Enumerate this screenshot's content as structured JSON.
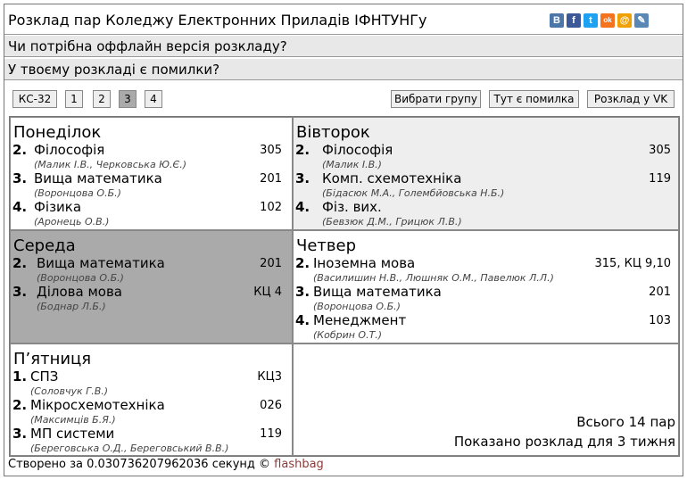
{
  "header": {
    "title": "Розклад пар Коледжу Електронних Приладів ІФНТУНГу",
    "share_icons": [
      {
        "name": "vk-icon",
        "glyph": "В",
        "color": "#4a76a8"
      },
      {
        "name": "facebook-icon",
        "glyph": "f",
        "color": "#3b5998"
      },
      {
        "name": "twitter-icon",
        "glyph": "t",
        "color": "#1da1f2"
      },
      {
        "name": "odnoklassniki-icon",
        "glyph": "ok",
        "color": "#f4731c"
      },
      {
        "name": "mail-icon",
        "glyph": "@",
        "color": "#f0a000"
      },
      {
        "name": "livejournal-icon",
        "glyph": "✎",
        "color": "#5b87b7"
      }
    ]
  },
  "notices": {
    "offline": "Чи потрібна оффлайн версія розкладу?",
    "errors": "У твоєму розкладі є помилки?"
  },
  "controls": {
    "group": "КС-32",
    "weeks": [
      "1",
      "2",
      "3",
      "4"
    ],
    "active_week": "3",
    "choose_group": "Вибрати групу",
    "report_error": "Тут є помилка",
    "vk_schedule": "Розклад у VK"
  },
  "days": {
    "mon": {
      "name": "Понеділок",
      "lessons": [
        {
          "num": "2.",
          "name": "Філософія",
          "room": "305",
          "teachers": "(Малик І.В., Черковська Ю.Є.)"
        },
        {
          "num": "3.",
          "name": "Вища математика",
          "room": "201",
          "teachers": "(Воронцова О.Б.)"
        },
        {
          "num": "4.",
          "name": "Фізика",
          "room": "102",
          "teachers": "(Аронець О.В.)"
        }
      ]
    },
    "tue": {
      "name": "Вівторок",
      "lessons": [
        {
          "num": "2.",
          "name": "Філософія",
          "room": "305",
          "teachers": "(Малик І.В.)"
        },
        {
          "num": "3.",
          "name": "Комп. схемотехніка",
          "room": "119",
          "teachers": "(Бідасюк М.А., Голембйовська Н.Б.)"
        },
        {
          "num": "4.",
          "name": "Фіз. вих.",
          "room": "",
          "teachers": "(Бевзюк Д.М., Грицюк Л.В.)"
        }
      ]
    },
    "wed": {
      "name": "Середа",
      "lessons": [
        {
          "num": "2.",
          "name": "Вища математика",
          "room": "201",
          "teachers": "(Воронцова О.Б.)"
        },
        {
          "num": "3.",
          "name": "Ділова мова",
          "room": "КЦ 4",
          "teachers": "(Боднар Л.Б.)"
        }
      ]
    },
    "thu": {
      "name": "Четвер",
      "lessons": [
        {
          "num": "2.",
          "name": "Іноземна мова",
          "room": "315, КЦ 9,10",
          "teachers": "(Василишин Н.В., Люшняк О.М., Павелюк Л.Л.)"
        },
        {
          "num": "3.",
          "name": "Вища математика",
          "room": "201",
          "teachers": "(Воронцова О.Б.)"
        },
        {
          "num": "4.",
          "name": "Менеджмент",
          "room": "103",
          "teachers": "(Кобрин О.Т.)"
        }
      ]
    },
    "fri": {
      "name": "П’ятниця",
      "lessons": [
        {
          "num": "1.",
          "name": "СПЗ",
          "room": "КЦ3",
          "teachers": "(Соловчук Г.В.)"
        },
        {
          "num": "2.",
          "name": "Мікросхемотехніка",
          "room": "026",
          "teachers": "(Максимців Б.Я.)"
        },
        {
          "num": "3.",
          "name": "МП системи",
          "room": "119",
          "teachers": "(Береговська О.Д., Береговський В.В.)"
        }
      ]
    }
  },
  "summary": {
    "total": "Всього 14 пар",
    "week_shown": "Показано розклад для 3 тижня"
  },
  "footer": {
    "created": "Створено за 0.030736207962036 секунд ©",
    "author": "flashbag"
  }
}
